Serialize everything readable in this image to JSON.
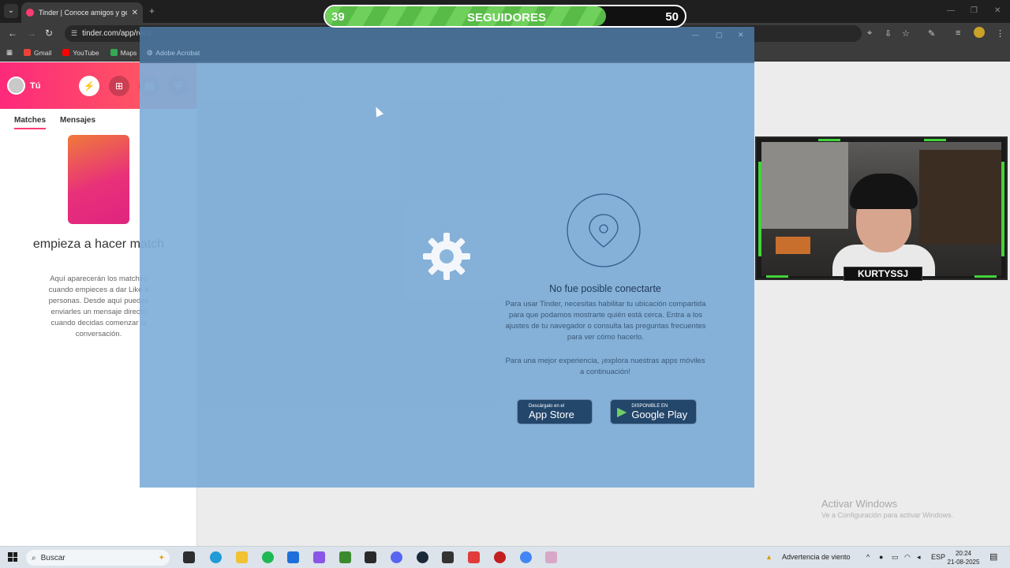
{
  "browser": {
    "tab_title": "Tinder | Conoce amigos y gente",
    "url": "tinder.com/app/recs",
    "bookmarks": [
      {
        "label": "Gmail",
        "color": "#ea4335"
      },
      {
        "label": "YouTube",
        "color": "#ff0000"
      },
      {
        "label": "Maps",
        "color": "#34a853"
      }
    ]
  },
  "sidebar": {
    "user_label": "Tú",
    "tabs": [
      "Matches",
      "Mensajes"
    ],
    "empty_title": "empieza a hacer match",
    "empty_desc": "Aquí aparecerán los matches cuando empieces a dar Like a personas. Desde aquí puedes enviarles un mensaje directo cuando decidas comenzar la conversación."
  },
  "overlay": {
    "bookmark": "Adobe Acrobat",
    "error_title": "No fue posible conectarte",
    "error_body": "Para usar Tinder, necesitas habilitar tu ubicación compartida para que podamos mostrarte quién está cerca. Entra a los ajustes de tu navegador o consulta las preguntas frecuentes para ver cómo hacerlo.",
    "apps_text": "Para una mejor experiencia, ¡explora nuestras apps móviles a continuación!",
    "app_store": {
      "small": "Descárgalo en el",
      "big": "App Store"
    },
    "google_play": {
      "small": "DISPONIBLE EN",
      "big": "Google Play"
    }
  },
  "stream": {
    "followers_current": "39",
    "followers_label": "SEGUIDORES",
    "followers_goal": "50",
    "followers_progress": 0.78,
    "streamer_name": "KURTYSSJ"
  },
  "watermark": {
    "title": "Activar Windows",
    "subtitle": "Ve a Configuración para activar Windows."
  },
  "taskbar": {
    "search_label": "Buscar",
    "weather": "Advertencia de viento",
    "lang": "ESP",
    "time": "20:24",
    "date": "21-08-2025"
  },
  "colors": {
    "tinder_gradient_start": "#fd297b",
    "tinder_gradient_end": "#ff655b",
    "progress_green": "#6fd15b",
    "cam_accent": "#42d43a"
  }
}
